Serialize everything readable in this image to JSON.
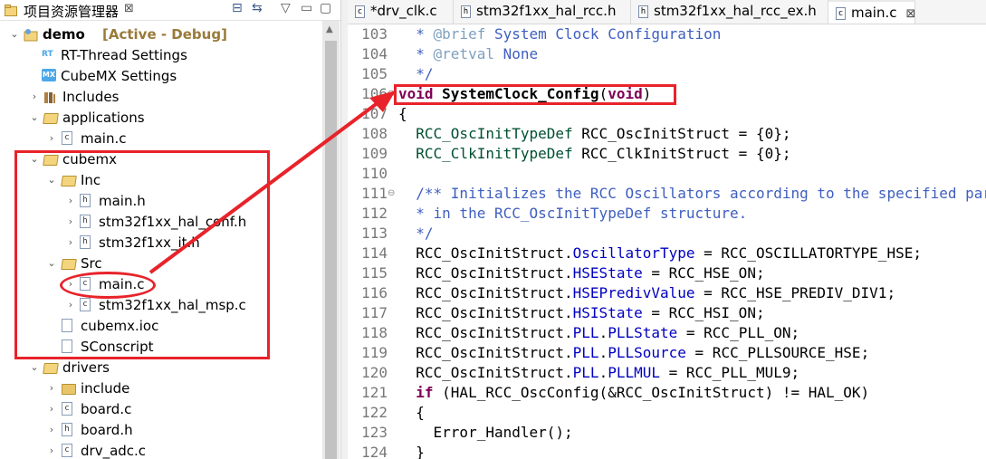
{
  "explorer": {
    "title": "项目资源管理器",
    "close_glyph": "⊠",
    "toolbar_icons": [
      "collapse-all-icon",
      "link-with-editor-icon",
      "view-menu-icon",
      "minimize-icon",
      "maximize-icon"
    ],
    "toolbar_glyphs": [
      "⊟",
      "⇆",
      "▽",
      "▭",
      "▢"
    ],
    "tree": [
      {
        "label": "demo",
        "extra": "[Active - Debug]",
        "twisty": "⌄",
        "icon": "project-icon"
      },
      {
        "label": "RT-Thread Settings",
        "twisty": "",
        "icon": "rt-thread-icon",
        "icon_text": "RT"
      },
      {
        "label": "CubeMX Settings",
        "twisty": "",
        "icon": "cubemx-icon",
        "icon_text": "MX"
      },
      {
        "label": "Includes",
        "twisty": "›",
        "icon": "includes-icon"
      },
      {
        "label": "applications",
        "twisty": "⌄",
        "icon": "folder-open-icon"
      },
      {
        "label": "main.c",
        "twisty": "›",
        "icon": "c-file-icon",
        "icon_text": "c"
      },
      {
        "label": "cubemx",
        "twisty": "⌄",
        "icon": "folder-open-icon"
      },
      {
        "label": "Inc",
        "twisty": "⌄",
        "icon": "folder-open-icon"
      },
      {
        "label": "main.h",
        "twisty": "›",
        "icon": "h-file-icon",
        "icon_text": "h"
      },
      {
        "label": "stm32f1xx_hal_conf.h",
        "twisty": "›",
        "icon": "h-file-icon",
        "icon_text": "h"
      },
      {
        "label": "stm32f1xx_it.h",
        "twisty": "›",
        "icon": "h-file-icon",
        "icon_text": "h"
      },
      {
        "label": "Src",
        "twisty": "⌄",
        "icon": "folder-open-icon"
      },
      {
        "label": "main.c",
        "twisty": "›",
        "icon": "c-file-icon",
        "icon_text": "c"
      },
      {
        "label": "stm32f1xx_hal_msp.c",
        "twisty": "›",
        "icon": "c-file-icon",
        "icon_text": "c"
      },
      {
        "label": "cubemx.ioc",
        "twisty": "",
        "icon": "file-icon",
        "icon_text": ""
      },
      {
        "label": "SConscript",
        "twisty": "",
        "icon": "file-icon",
        "icon_text": ""
      },
      {
        "label": "drivers",
        "twisty": "⌄",
        "icon": "folder-open-icon"
      },
      {
        "label": "include",
        "twisty": "›",
        "icon": "folder-icon"
      },
      {
        "label": "board.c",
        "twisty": "›",
        "icon": "c-file-icon",
        "icon_text": "c"
      },
      {
        "label": "board.h",
        "twisty": "›",
        "icon": "h-file-icon",
        "icon_text": "h"
      },
      {
        "label": "drv_adc.c",
        "twisty": "›",
        "icon": "c-file-icon",
        "icon_text": "c"
      }
    ]
  },
  "editor": {
    "tabs": [
      {
        "label": "*drv_clk.c",
        "icon_text": "c",
        "active": false
      },
      {
        "label": "stm32f1xx_hal_rcc.h",
        "icon_text": "h",
        "active": false
      },
      {
        "label": "stm32f1xx_hal_rcc_ex.h",
        "icon_text": "h",
        "active": false
      },
      {
        "label": "main.c",
        "icon_text": "c",
        "active": true,
        "close": "⊠"
      }
    ],
    "lines": [
      {
        "n": "103",
        "fold": "",
        "code": [
          [
            "cm",
            "  * "
          ],
          [
            "tag",
            "@brief"
          ],
          [
            "cm",
            " System Clock Configuration"
          ]
        ]
      },
      {
        "n": "104",
        "fold": "",
        "code": [
          [
            "cm",
            "  * "
          ],
          [
            "tag",
            "@retval"
          ],
          [
            "cm",
            " None"
          ]
        ]
      },
      {
        "n": "105",
        "fold": "",
        "code": [
          [
            "cm",
            "  */"
          ]
        ]
      },
      {
        "n": "106",
        "fold": "⊖",
        "code": [
          [
            "kw",
            "void"
          ],
          [
            "",
            " "
          ],
          [
            "fn",
            "SystemClock_Config"
          ],
          [
            "",
            "("
          ],
          [
            "kw",
            "void"
          ],
          [
            "",
            ")"
          ]
        ]
      },
      {
        "n": "107",
        "fold": "",
        "code": [
          [
            "",
            "{"
          ]
        ]
      },
      {
        "n": "108",
        "fold": "",
        "code": [
          [
            "",
            "  "
          ],
          [
            "ty",
            "RCC_OscInitTypeDef"
          ],
          [
            "",
            " RCC_OscInitStruct = {0};"
          ]
        ]
      },
      {
        "n": "109",
        "fold": "",
        "code": [
          [
            "",
            "  "
          ],
          [
            "ty",
            "RCC_ClkInitTypeDef"
          ],
          [
            "",
            " RCC_ClkInitStruct = {0};"
          ]
        ]
      },
      {
        "n": "110",
        "fold": "",
        "code": [
          [
            "",
            ""
          ]
        ]
      },
      {
        "n": "111",
        "fold": "⊖",
        "code": [
          [
            "cm",
            "  /** Initializes the RCC Oscillators according to the specified parameters"
          ]
        ]
      },
      {
        "n": "112",
        "fold": "",
        "code": [
          [
            "cm",
            "  * in the RCC_OscInitTypeDef structure."
          ]
        ]
      },
      {
        "n": "113",
        "fold": "",
        "code": [
          [
            "cm",
            "  */"
          ]
        ]
      },
      {
        "n": "114",
        "fold": "",
        "code": [
          [
            "",
            "  RCC_OscInitStruct."
          ],
          [
            "fld",
            "OscillatorType"
          ],
          [
            "",
            " = RCC_OSCILLATORTYPE_HSE;"
          ]
        ]
      },
      {
        "n": "115",
        "fold": "",
        "code": [
          [
            "",
            "  RCC_OscInitStruct."
          ],
          [
            "fld",
            "HSEState"
          ],
          [
            "",
            " = RCC_HSE_ON;"
          ]
        ]
      },
      {
        "n": "116",
        "fold": "",
        "code": [
          [
            "",
            "  RCC_OscInitStruct."
          ],
          [
            "fld",
            "HSEPredivValue"
          ],
          [
            "",
            " = RCC_HSE_PREDIV_DIV1;"
          ]
        ]
      },
      {
        "n": "117",
        "fold": "",
        "code": [
          [
            "",
            "  RCC_OscInitStruct."
          ],
          [
            "fld",
            "HSIState"
          ],
          [
            "",
            " = RCC_HSI_ON;"
          ]
        ]
      },
      {
        "n": "118",
        "fold": "",
        "code": [
          [
            "",
            "  RCC_OscInitStruct."
          ],
          [
            "fld",
            "PLL"
          ],
          [
            "",
            "."
          ],
          [
            "fld",
            "PLLState"
          ],
          [
            "",
            " = RCC_PLL_ON;"
          ]
        ]
      },
      {
        "n": "119",
        "fold": "",
        "code": [
          [
            "",
            "  RCC_OscInitStruct."
          ],
          [
            "fld",
            "PLL"
          ],
          [
            "",
            "."
          ],
          [
            "fld",
            "PLLSource"
          ],
          [
            "",
            " = RCC_PLLSOURCE_HSE;"
          ]
        ]
      },
      {
        "n": "120",
        "fold": "",
        "code": [
          [
            "",
            "  RCC_OscInitStruct."
          ],
          [
            "fld",
            "PLL"
          ],
          [
            "",
            "."
          ],
          [
            "fld",
            "PLLMUL"
          ],
          [
            "",
            " = RCC_PLL_MUL9;"
          ]
        ]
      },
      {
        "n": "121",
        "fold": "",
        "code": [
          [
            "",
            "  "
          ],
          [
            "kw",
            "if"
          ],
          [
            "",
            " (HAL_RCC_OscConfig(&RCC_OscInitStruct) != HAL_OK)"
          ]
        ]
      },
      {
        "n": "122",
        "fold": "",
        "code": [
          [
            "",
            "  {"
          ]
        ]
      },
      {
        "n": "123",
        "fold": "",
        "code": [
          [
            "",
            "    Error_Handler();"
          ]
        ]
      },
      {
        "n": "124",
        "fold": "",
        "code": [
          [
            "",
            "  }"
          ]
        ]
      }
    ]
  },
  "colors": {
    "annotation_red": "#e8232a",
    "comment_blue": "#3f5fbf",
    "keyword_purple": "#7f0055",
    "type_green": "#005032",
    "field_blue": "#0000c0"
  }
}
